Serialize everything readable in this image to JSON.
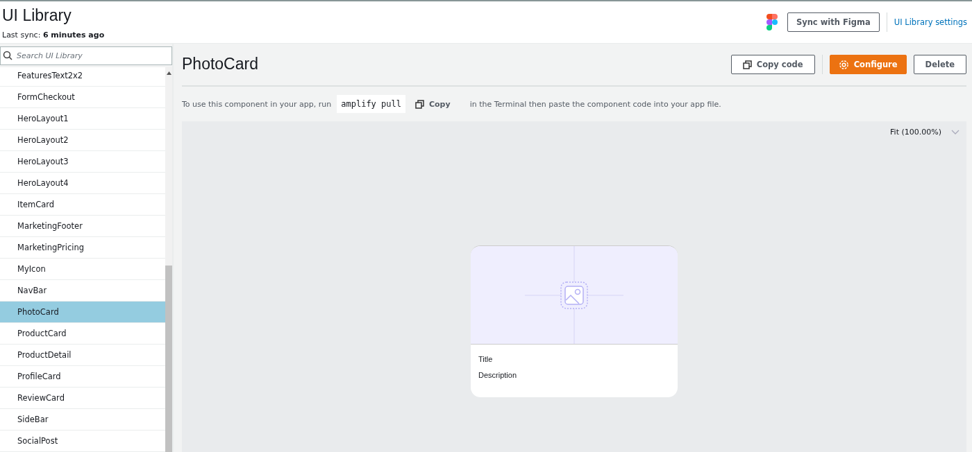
{
  "header": {
    "title": "UI Library",
    "sync_label": "Last sync:",
    "sync_value": "6 minutes ago",
    "sync_button": "Sync with Figma",
    "settings_link": "UI Library settings"
  },
  "sidebar": {
    "search": {
      "placeholder": "Search UI Library"
    },
    "items": [
      {
        "label": "FeaturesText2x2",
        "selected": false
      },
      {
        "label": "FormCheckout",
        "selected": false
      },
      {
        "label": "HeroLayout1",
        "selected": false
      },
      {
        "label": "HeroLayout2",
        "selected": false
      },
      {
        "label": "HeroLayout3",
        "selected": false
      },
      {
        "label": "HeroLayout4",
        "selected": false
      },
      {
        "label": "ItemCard",
        "selected": false
      },
      {
        "label": "MarketingFooter",
        "selected": false
      },
      {
        "label": "MarketingPricing",
        "selected": false
      },
      {
        "label": "MyIcon",
        "selected": false
      },
      {
        "label": "NavBar",
        "selected": false
      },
      {
        "label": "PhotoCard",
        "selected": true
      },
      {
        "label": "ProductCard",
        "selected": false
      },
      {
        "label": "ProductDetail",
        "selected": false
      },
      {
        "label": "ProfileCard",
        "selected": false
      },
      {
        "label": "ReviewCard",
        "selected": false
      },
      {
        "label": "SideBar",
        "selected": false
      },
      {
        "label": "SocialPost",
        "selected": false
      }
    ]
  },
  "main": {
    "title": "PhotoCard",
    "buttons": [
      {
        "label": "Copy code",
        "kind": "copy"
      },
      {
        "label": "Configure",
        "kind": "primary"
      },
      {
        "label": "Delete",
        "kind": "plain"
      }
    ],
    "instruction": {
      "before": "To use this component in your app, run",
      "command": "amplify pull",
      "copy": "Copy",
      "after": "in the Terminal then paste the component code into your app file."
    },
    "zoom": "Fit (100.00%)",
    "preview": {
      "title": "Title",
      "description": "Description"
    }
  }
}
